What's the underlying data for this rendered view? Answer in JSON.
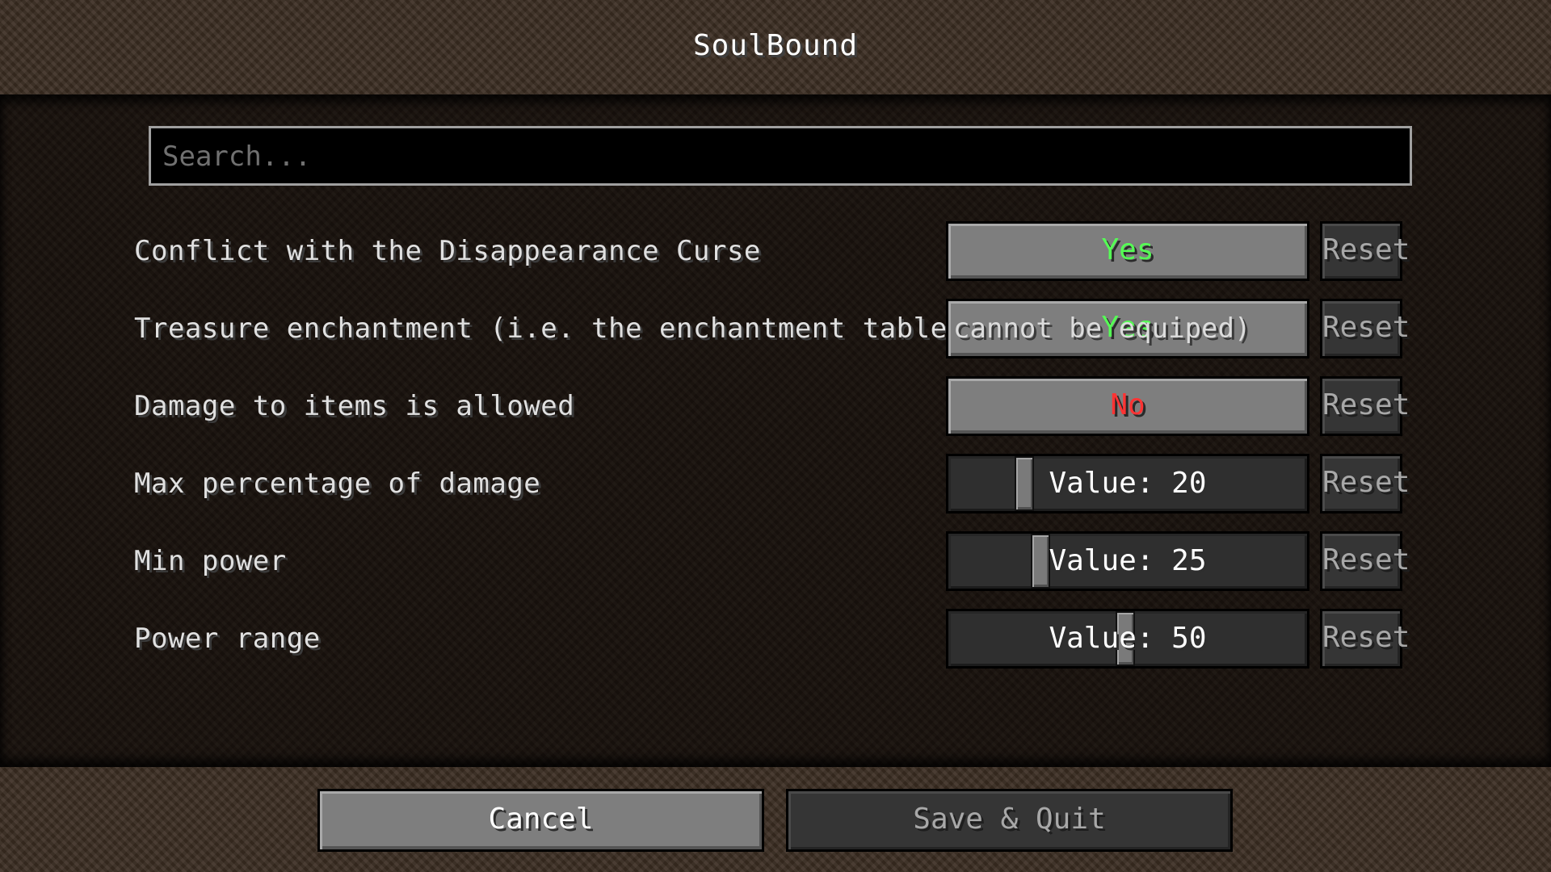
{
  "window": {
    "title": "SoulBound"
  },
  "search": {
    "placeholder": "Search..."
  },
  "colors": {
    "yes": "#55ff55",
    "no": "#ff3333",
    "accent_text": "#ffffff"
  },
  "options": [
    {
      "label": "Conflict with the Disappearance Curse",
      "type": "toggle",
      "value": "Yes",
      "reset": "Reset"
    },
    {
      "label": "Treasure enchantment (i.e. the enchantment table",
      "overflow_label": "cannot be equiped)",
      "type": "toggle",
      "value": "Yes",
      "reset": "Reset"
    },
    {
      "label": "Damage to items is allowed",
      "type": "toggle",
      "value": "No",
      "reset": "Reset"
    },
    {
      "label": "Max percentage of damage",
      "type": "slider",
      "value_text": "Value: 20",
      "value": 20,
      "reset": "Reset"
    },
    {
      "label": "Min power",
      "type": "slider",
      "value_text": "Value: 25",
      "value": 25,
      "reset": "Reset"
    },
    {
      "label": "Power range",
      "type": "slider",
      "value_text": "Value: 50",
      "value": 50,
      "reset": "Reset"
    }
  ],
  "footer": {
    "cancel": "Cancel",
    "save": "Save & Quit"
  }
}
